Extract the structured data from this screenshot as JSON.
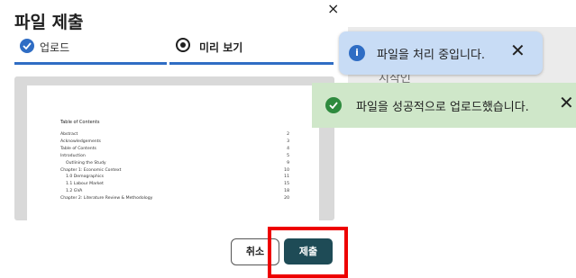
{
  "background": {
    "behind_text": "시작인"
  },
  "dialog": {
    "title": "파일 제출",
    "close_label": "×",
    "steps": [
      {
        "label": "업로드",
        "state": "complete"
      },
      {
        "label": "미리 보기",
        "state": "current"
      }
    ],
    "preview": {
      "toc_title": "Table of Contents",
      "toc": [
        {
          "title": "Abstract",
          "page": "2",
          "indent": 0
        },
        {
          "title": "Acknowledgements",
          "page": "3",
          "indent": 0
        },
        {
          "title": "Table of Contents",
          "page": "4",
          "indent": 0
        },
        {
          "title": "Introduction",
          "page": "5",
          "indent": 0
        },
        {
          "title": "Outlining the Study",
          "page": "9",
          "indent": 1
        },
        {
          "title": "Chapter 1: Economic Context",
          "page": "10",
          "indent": 0
        },
        {
          "title": "1.0 Demographics",
          "page": "11",
          "indent": 1
        },
        {
          "title": "1.1 Labour Market",
          "page": "15",
          "indent": 1
        },
        {
          "title": "1.2 GVA",
          "page": "18",
          "indent": 1
        },
        {
          "title": "Chapter 2: Literature Review & Methodology",
          "page": "20",
          "indent": 0
        }
      ]
    },
    "cancel_label": "취소",
    "submit_label": "제출"
  },
  "toasts": {
    "info": {
      "message": "파일을 처리 중입니다.",
      "close_label": "✕",
      "icon": "info-icon"
    },
    "success": {
      "message": "파일을 성공적으로 업로드했습니다.",
      "close_label": "✕",
      "icon": "check-circle-icon"
    }
  },
  "colors": {
    "accent": "#2f6dc4",
    "submit_bg": "#1e4b56",
    "highlight": "#ee0000",
    "info_toast_bg": "#c8dcf5",
    "success_toast_bg": "#cfe7c9",
    "success_icon": "#2e8a3e"
  }
}
